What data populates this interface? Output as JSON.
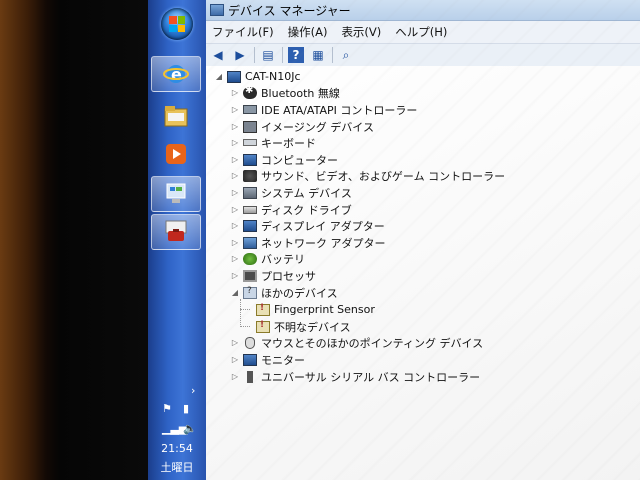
{
  "window": {
    "title": "デバイス マネージャー"
  },
  "menu": [
    "ファイル(F)",
    "操作(A)",
    "表示(V)",
    "ヘルプ(H)"
  ],
  "toolbar": {
    "icons": [
      "back-arrow-icon",
      "forward-arrow-icon",
      "console-tree-icon",
      "help-icon",
      "properties-icon",
      "scan-hardware-icon"
    ]
  },
  "tree": {
    "root": "CAT-N10Jc",
    "categories": [
      {
        "label": "Bluetooth 無線",
        "icon": "bluetooth-icon",
        "expanded": false
      },
      {
        "label": "IDE ATA/ATAPI コントローラー",
        "icon": "ide-controller-icon",
        "expanded": false
      },
      {
        "label": "イメージング デバイス",
        "icon": "camera-icon",
        "expanded": false
      },
      {
        "label": "キーボード",
        "icon": "keyboard-icon",
        "expanded": false
      },
      {
        "label": "コンピューター",
        "icon": "computer-icon",
        "expanded": false
      },
      {
        "label": "サウンド、ビデオ、およびゲーム コントローラー",
        "icon": "speaker-icon",
        "expanded": false
      },
      {
        "label": "システム デバイス",
        "icon": "system-device-icon",
        "expanded": false
      },
      {
        "label": "ディスク ドライブ",
        "icon": "disk-drive-icon",
        "expanded": false
      },
      {
        "label": "ディスプレイ アダプター",
        "icon": "display-adapter-icon",
        "expanded": false
      },
      {
        "label": "ネットワーク アダプター",
        "icon": "network-adapter-icon",
        "expanded": false
      },
      {
        "label": "バッテリ",
        "icon": "battery-icon",
        "expanded": false
      },
      {
        "label": "プロセッサ",
        "icon": "processor-icon",
        "expanded": false
      },
      {
        "label": "ほかのデバイス",
        "icon": "other-devices-icon",
        "expanded": true,
        "children": [
          {
            "label": "Fingerprint Sensor",
            "icon": "warning-device-icon"
          },
          {
            "label": "不明なデバイス",
            "icon": "warning-device-icon"
          }
        ]
      },
      {
        "label": "マウスとそのほかのポインティング デバイス",
        "icon": "mouse-icon",
        "expanded": false
      },
      {
        "label": "モニター",
        "icon": "monitor-icon",
        "expanded": false
      },
      {
        "label": "ユニバーサル シリアル バス コントローラー",
        "icon": "usb-icon",
        "expanded": false
      }
    ]
  },
  "taskbar": {
    "apps": [
      "internet-explorer-icon",
      "windows-explorer-icon",
      "media-player-icon",
      "control-panel-icon",
      "device-manager-icon"
    ],
    "clock": "21:54",
    "day": "土曜日"
  }
}
